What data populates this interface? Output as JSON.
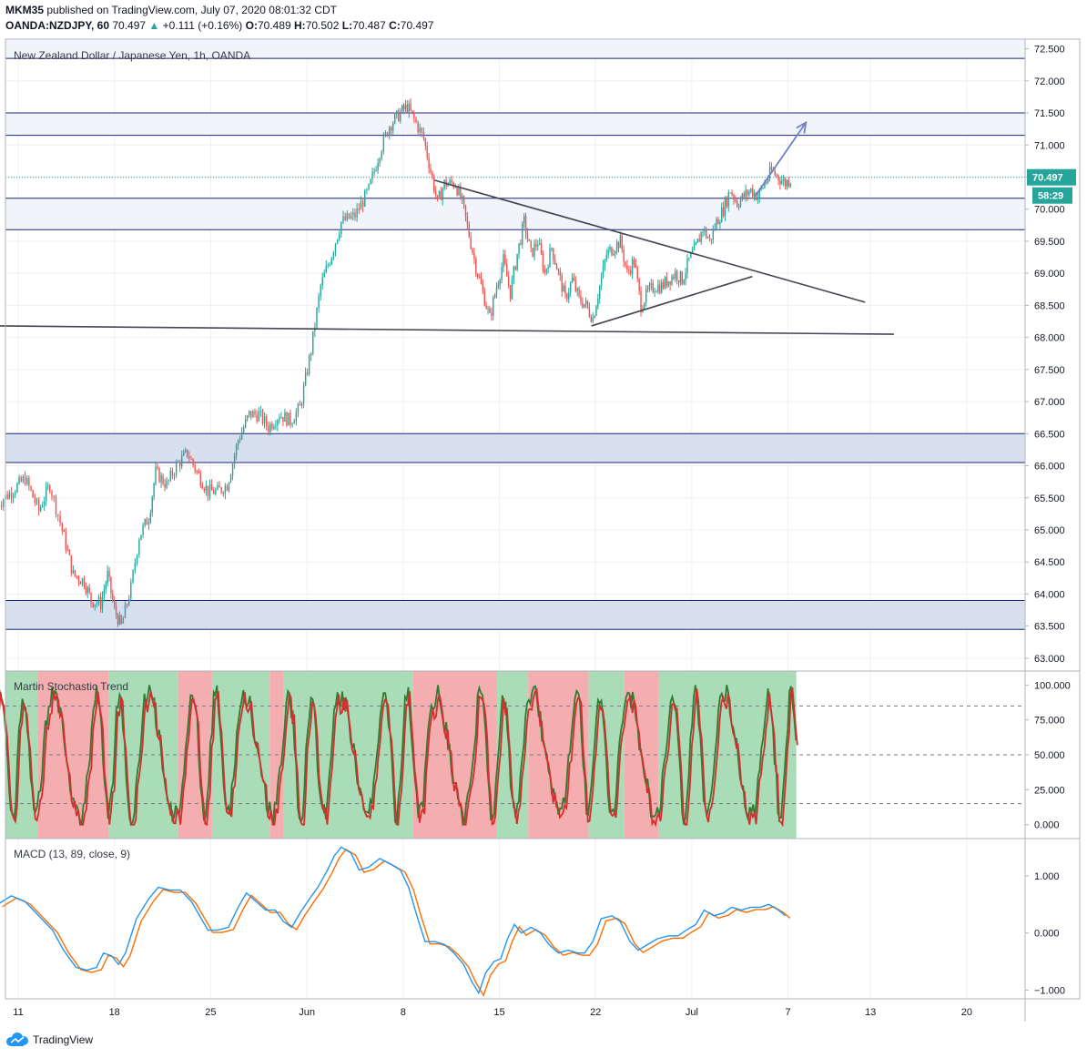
{
  "header": {
    "author": "MKM35",
    "published_text": "published on TradingView.com, July 07, 2020 08:01:32 CDT",
    "symbol": "OANDA:NZDJPY, 60",
    "last": "70.497",
    "change_arrow": "▲",
    "change": "+0.111 (+0.16%)",
    "o_label": "O:",
    "o": "70.489",
    "h_label": "H:",
    "h": "70.502",
    "l_label": "L:",
    "l": "70.487",
    "c_label": "C:",
    "c": "70.497"
  },
  "chart_data": [
    {
      "type": "candlestick",
      "title": "New Zealand Dollar / Japanese Yen, 1h, OANDA",
      "ylim": [
        62.8,
        72.65
      ],
      "y_ticks": [
        "72.500",
        "72.000",
        "71.500",
        "71.000",
        "70.500",
        "70.000",
        "69.500",
        "69.000",
        "68.500",
        "68.000",
        "67.500",
        "67.000",
        "66.500",
        "66.000",
        "65.500",
        "65.000",
        "64.500",
        "64.000",
        "63.500",
        "63.000"
      ],
      "x_ticks": [
        "11",
        "18",
        "25",
        "Jun",
        "8",
        "15",
        "22",
        "Jul",
        "7",
        "13",
        "20"
      ],
      "x_tick_days": [
        0,
        7,
        14,
        21,
        28,
        35,
        42,
        49,
        56,
        62,
        69
      ],
      "last_price_label": "70.497",
      "countdown_label": "58:29",
      "zones": [
        {
          "low": 72.35,
          "high": 72.65
        },
        {
          "low": 71.15,
          "high": 71.5
        },
        {
          "low": 69.68,
          "high": 70.17
        },
        {
          "low": 66.05,
          "high": 66.5
        },
        {
          "low": 63.45,
          "high": 63.9
        }
      ],
      "trendlines": [
        {
          "from": [
            -1.5,
            68.18
          ],
          "to": [
            63.7,
            68.05
          ]
        },
        {
          "from": [
            30.3,
            70.45
          ],
          "to": [
            61.6,
            68.55
          ]
        },
        {
          "from": [
            41.7,
            68.18
          ],
          "to": [
            53.4,
            68.95
          ]
        }
      ],
      "arrow": {
        "from": [
          53.6,
          70.2
        ],
        "to": [
          57.3,
          71.35
        ]
      },
      "close_path": [
        [
          -1.5,
          65.4
        ],
        [
          -0.5,
          65.6
        ],
        [
          0.5,
          65.8
        ],
        [
          1.5,
          65.3
        ],
        [
          2.3,
          65.7
        ],
        [
          3.2,
          65.0
        ],
        [
          4.0,
          64.3
        ],
        [
          4.8,
          64.2
        ],
        [
          5.3,
          63.9
        ],
        [
          6.0,
          63.85
        ],
        [
          6.5,
          64.3
        ],
        [
          7.0,
          63.75
        ],
        [
          7.5,
          63.5
        ],
        [
          8.2,
          64.1
        ],
        [
          8.8,
          64.9
        ],
        [
          9.5,
          65.2
        ],
        [
          10.0,
          65.9
        ],
        [
          10.8,
          65.7
        ],
        [
          11.5,
          66.0
        ],
        [
          12.3,
          66.2
        ],
        [
          13.0,
          65.9
        ],
        [
          13.8,
          65.6
        ],
        [
          14.5,
          65.6
        ],
        [
          15.2,
          65.7
        ],
        [
          16.0,
          66.4
        ],
        [
          16.8,
          66.8
        ],
        [
          17.5,
          66.8
        ],
        [
          18.2,
          66.6
        ],
        [
          19.0,
          66.8
        ],
        [
          19.8,
          66.7
        ],
        [
          20.5,
          66.9
        ],
        [
          21.3,
          67.8
        ],
        [
          22.0,
          68.8
        ],
        [
          22.8,
          69.3
        ],
        [
          23.5,
          69.8
        ],
        [
          24.5,
          69.9
        ],
        [
          25.5,
          70.3
        ],
        [
          26.3,
          70.9
        ],
        [
          27.0,
          71.3
        ],
        [
          27.8,
          71.5
        ],
        [
          28.3,
          71.6
        ],
        [
          28.8,
          71.4
        ],
        [
          29.5,
          71.1
        ],
        [
          30.0,
          70.6
        ],
        [
          30.5,
          70.1
        ],
        [
          31.0,
          70.4
        ],
        [
          31.8,
          70.4
        ],
        [
          32.3,
          70.1
        ],
        [
          32.8,
          69.6
        ],
        [
          33.3,
          69.1
        ],
        [
          33.8,
          68.7
        ],
        [
          34.3,
          68.3
        ],
        [
          34.8,
          68.8
        ],
        [
          35.3,
          69.2
        ],
        [
          35.8,
          68.7
        ],
        [
          36.3,
          69.3
        ],
        [
          36.8,
          69.8
        ],
        [
          37.3,
          69.3
        ],
        [
          37.8,
          69.5
        ],
        [
          38.3,
          69.0
        ],
        [
          38.8,
          69.4
        ],
        [
          39.3,
          69.0
        ],
        [
          39.8,
          68.6
        ],
        [
          40.3,
          68.9
        ],
        [
          40.8,
          68.6
        ],
        [
          41.3,
          68.5
        ],
        [
          41.8,
          68.3
        ],
        [
          42.3,
          68.8
        ],
        [
          42.8,
          69.3
        ],
        [
          43.3,
          69.4
        ],
        [
          43.8,
          69.5
        ],
        [
          44.3,
          69.0
        ],
        [
          44.8,
          69.2
        ],
        [
          45.3,
          68.5
        ],
        [
          45.8,
          68.7
        ],
        [
          46.3,
          68.8
        ],
        [
          46.8,
          68.8
        ],
        [
          47.3,
          68.9
        ],
        [
          47.8,
          69.0
        ],
        [
          48.3,
          68.9
        ],
        [
          48.8,
          69.2
        ],
        [
          49.3,
          69.4
        ],
        [
          49.8,
          69.7
        ],
        [
          50.3,
          69.5
        ],
        [
          50.8,
          69.8
        ],
        [
          51.3,
          70.0
        ],
        [
          51.8,
          70.3
        ],
        [
          52.3,
          70.1
        ],
        [
          52.8,
          70.2
        ],
        [
          53.3,
          70.3
        ],
        [
          53.8,
          70.2
        ],
        [
          54.3,
          70.4
        ],
        [
          54.8,
          70.6
        ],
        [
          55.3,
          70.5
        ],
        [
          55.8,
          70.4
        ],
        [
          56.3,
          70.5
        ]
      ]
    },
    {
      "type": "line",
      "title": "Martin Stochastic Trend",
      "ylim": [
        -10,
        110
      ],
      "y_ticks": [
        "100.000",
        "75.000",
        "50.000",
        "25.000",
        "0.000"
      ],
      "levels": [
        85,
        50,
        15
      ],
      "series": [
        {
          "color": "#d32f2f"
        },
        {
          "color": "#2e7d32"
        }
      ],
      "regions": [
        {
          "from": -1.5,
          "to": 1.4,
          "color": "green"
        },
        {
          "from": 1.4,
          "to": 6.6,
          "color": "red"
        },
        {
          "from": 6.6,
          "to": 11.6,
          "color": "green"
        },
        {
          "from": 11.6,
          "to": 14.1,
          "color": "red"
        },
        {
          "from": 14.1,
          "to": 18.3,
          "color": "green"
        },
        {
          "from": 18.3,
          "to": 19.3,
          "color": "red"
        },
        {
          "from": 19.3,
          "to": 28.7,
          "color": "green"
        },
        {
          "from": 28.7,
          "to": 34.8,
          "color": "red"
        },
        {
          "from": 34.8,
          "to": 37.1,
          "color": "green"
        },
        {
          "from": 37.1,
          "to": 41.5,
          "color": "red"
        },
        {
          "from": 41.5,
          "to": 44.1,
          "color": "green"
        },
        {
          "from": 44.1,
          "to": 46.6,
          "color": "red"
        },
        {
          "from": 46.6,
          "to": 56.6,
          "color": "green"
        }
      ]
    },
    {
      "type": "line",
      "title": "MACD (13, 89, close, 9)",
      "ylim": [
        -1.15,
        1.65
      ],
      "y_ticks": [
        "1.000",
        "0.000",
        "−1.000"
      ],
      "series": [
        {
          "name": "macd",
          "color": "#2196f3"
        },
        {
          "name": "signal",
          "color": "#ff6d00"
        }
      ],
      "points": [
        [
          -1.5,
          0.5
        ],
        [
          -0.5,
          0.65
        ],
        [
          0.5,
          0.55
        ],
        [
          1.5,
          0.3
        ],
        [
          2.5,
          0.05
        ],
        [
          3.3,
          -0.3
        ],
        [
          4.2,
          -0.6
        ],
        [
          5.0,
          -0.65
        ],
        [
          5.7,
          -0.6
        ],
        [
          6.2,
          -0.35
        ],
        [
          6.8,
          -0.4
        ],
        [
          7.3,
          -0.55
        ],
        [
          7.8,
          -0.35
        ],
        [
          8.6,
          0.25
        ],
        [
          9.5,
          0.6
        ],
        [
          10.2,
          0.8
        ],
        [
          11.0,
          0.75
        ],
        [
          11.8,
          0.75
        ],
        [
          12.6,
          0.55
        ],
        [
          13.2,
          0.3
        ],
        [
          13.8,
          0.05
        ],
        [
          14.5,
          0.05
        ],
        [
          15.3,
          0.1
        ],
        [
          16.0,
          0.45
        ],
        [
          16.6,
          0.7
        ],
        [
          17.3,
          0.55
        ],
        [
          18.0,
          0.4
        ],
        [
          18.7,
          0.4
        ],
        [
          19.3,
          0.2
        ],
        [
          19.9,
          0.1
        ],
        [
          20.5,
          0.35
        ],
        [
          21.2,
          0.6
        ],
        [
          21.8,
          0.8
        ],
        [
          22.5,
          1.1
        ],
        [
          23.0,
          1.35
        ],
        [
          23.5,
          1.5
        ],
        [
          24.2,
          1.4
        ],
        [
          24.8,
          1.1
        ],
        [
          25.5,
          1.15
        ],
        [
          26.3,
          1.3
        ],
        [
          27.1,
          1.2
        ],
        [
          27.8,
          1.1
        ],
        [
          28.4,
          0.8
        ],
        [
          29.0,
          0.3
        ],
        [
          29.6,
          -0.15
        ],
        [
          30.3,
          -0.15
        ],
        [
          31.0,
          -0.2
        ],
        [
          31.7,
          -0.35
        ],
        [
          32.4,
          -0.55
        ],
        [
          33.0,
          -0.85
        ],
        [
          33.5,
          -1.05
        ],
        [
          34.0,
          -0.7
        ],
        [
          34.6,
          -0.5
        ],
        [
          35.1,
          -0.45
        ],
        [
          35.6,
          -0.1
        ],
        [
          36.1,
          0.15
        ],
        [
          36.6,
          0.0
        ],
        [
          37.3,
          0.1
        ],
        [
          38.0,
          0.0
        ],
        [
          38.6,
          -0.2
        ],
        [
          39.3,
          -0.35
        ],
        [
          40.0,
          -0.3
        ],
        [
          40.7,
          -0.35
        ],
        [
          41.2,
          -0.35
        ],
        [
          41.8,
          -0.15
        ],
        [
          42.4,
          0.25
        ],
        [
          43.2,
          0.3
        ],
        [
          43.8,
          0.2
        ],
        [
          44.5,
          -0.15
        ],
        [
          45.1,
          -0.3
        ],
        [
          45.8,
          -0.2
        ],
        [
          46.5,
          -0.1
        ],
        [
          47.3,
          -0.05
        ],
        [
          48.0,
          -0.05
        ],
        [
          48.6,
          0.05
        ],
        [
          49.3,
          0.15
        ],
        [
          49.9,
          0.4
        ],
        [
          50.6,
          0.3
        ],
        [
          51.3,
          0.35
        ],
        [
          51.9,
          0.45
        ],
        [
          52.6,
          0.4
        ],
        [
          53.3,
          0.45
        ],
        [
          54.0,
          0.45
        ],
        [
          54.6,
          0.5
        ],
        [
          55.3,
          0.4
        ],
        [
          55.8,
          0.3
        ]
      ]
    }
  ],
  "footer": {
    "brand": "TradingView"
  }
}
